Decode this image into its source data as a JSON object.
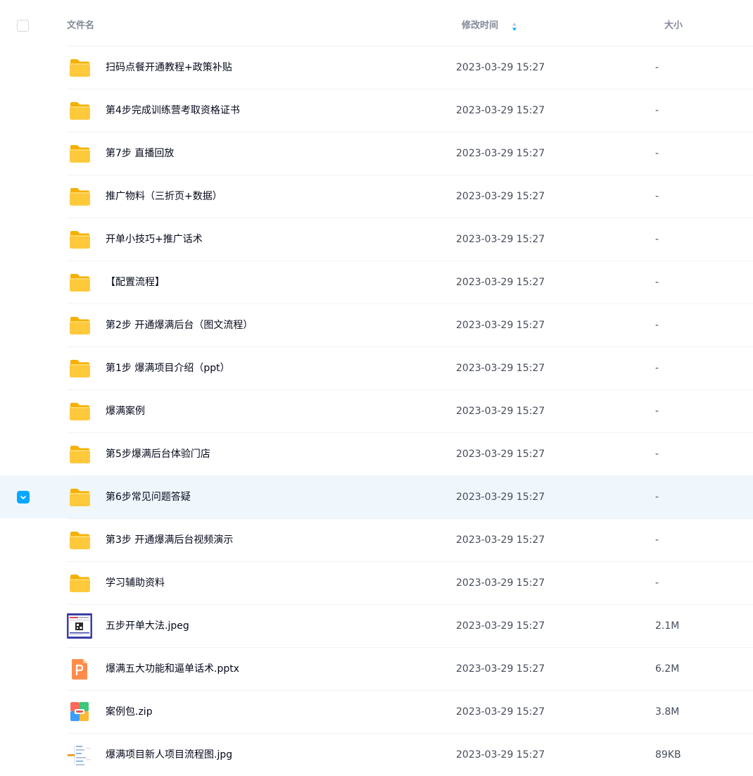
{
  "header": {
    "name_label": "文件名",
    "mtime_label": "修改时间",
    "size_label": "大小"
  },
  "colors": {
    "accent": "#06a7ff",
    "hover_row": "#eff7fd",
    "folder": "#ffc53d"
  },
  "files": [
    {
      "name": "扫码点餐开通教程+政策补贴",
      "mtime": "2023-03-29 15:27",
      "size": "-",
      "icon": "folder-icon"
    },
    {
      "name": "第4步完成训练营考取资格证书",
      "mtime": "2023-03-29 15:27",
      "size": "-",
      "icon": "folder-icon"
    },
    {
      "name": "第7步 直播回放",
      "mtime": "2023-03-29 15:27",
      "size": "-",
      "icon": "folder-icon"
    },
    {
      "name": "推广物料（三折页+数据）",
      "mtime": "2023-03-29 15:27",
      "size": "-",
      "icon": "folder-icon"
    },
    {
      "name": "开单小技巧+推广话术",
      "mtime": "2023-03-29 15:27",
      "size": "-",
      "icon": "folder-icon"
    },
    {
      "name": "【配置流程】",
      "mtime": "2023-03-29 15:27",
      "size": "-",
      "icon": "folder-icon"
    },
    {
      "name": "第2步 开通爆满后台（图文流程）",
      "mtime": "2023-03-29 15:27",
      "size": "-",
      "icon": "folder-icon"
    },
    {
      "name": "第1步 爆满项目介绍（ppt）",
      "mtime": "2023-03-29 15:27",
      "size": "-",
      "icon": "folder-icon"
    },
    {
      "name": "爆满案例",
      "mtime": "2023-03-29 15:27",
      "size": "-",
      "icon": "folder-icon"
    },
    {
      "name": "第5步爆满后台体验门店",
      "mtime": "2023-03-29 15:27",
      "size": "-",
      "icon": "folder-icon"
    },
    {
      "name": "第6步常见问题答疑",
      "mtime": "2023-03-29 15:27",
      "size": "-",
      "icon": "folder-icon",
      "hovered": true
    },
    {
      "name": "第3步 开通爆满后台视频演示",
      "mtime": "2023-03-29 15:27",
      "size": "-",
      "icon": "folder-icon"
    },
    {
      "name": "学习辅助资料",
      "mtime": "2023-03-29 15:27",
      "size": "-",
      "icon": "folder-icon"
    },
    {
      "name": "五步开单大法.jpeg",
      "mtime": "2023-03-29 15:27",
      "size": "2.1M",
      "icon": "image-thumbnail-icon"
    },
    {
      "name": "爆满五大功能和逼单话术.pptx",
      "mtime": "2023-03-29 15:27",
      "size": "6.2M",
      "icon": "pptx-file-icon"
    },
    {
      "name": "案例包.zip",
      "mtime": "2023-03-29 15:27",
      "size": "3.8M",
      "icon": "zip-file-icon"
    },
    {
      "name": "爆满项目新人项目流程图.jpg",
      "mtime": "2023-03-29 15:27",
      "size": "89KB",
      "icon": "flowchart-thumbnail-icon"
    }
  ]
}
